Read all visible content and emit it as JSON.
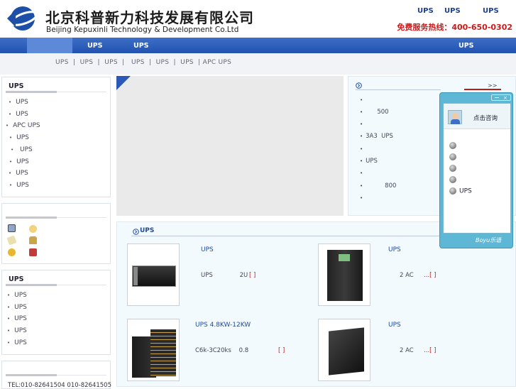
{
  "header": {
    "logo_cn": "北京科普新力科技发展有限公司",
    "logo_en": "Beijing Kepuxinli Technology & Development Co.Ltd",
    "top_links": [
      "UPS",
      "UPS",
      "UPS"
    ],
    "hotline": "免费服务热线：400-650-0302"
  },
  "nav": {
    "items": [
      "UPS",
      "UPS",
      "UPS"
    ]
  },
  "subnav": {
    "text": "UPS  |  UPS  |  UPS  |   UPS  |  UPS  |  UPS  | APC UPS"
  },
  "left_box1": {
    "title": "UPS",
    "items": [
      "UPS",
      "UPS",
      "APC UPS",
      "UPS",
      " UPS",
      "UPS",
      "UPS",
      "UPS"
    ]
  },
  "left_box3": {
    "title": "UPS",
    "items": [
      "UPS",
      "UPS",
      "UPS",
      "UPS",
      "UPS"
    ]
  },
  "contact": {
    "tel": "TEL:010-82641504 010-82641505"
  },
  "news": {
    "more": ">>",
    "items": [
      "",
      "      500",
      "",
      "3A3  UPS",
      "",
      "UPS",
      "",
      "          800",
      ""
    ]
  },
  "products": {
    "section_title": "UPS",
    "items": [
      {
        "title": "UPS",
        "desc": "UPS              2U",
        "more": "[ ]"
      },
      {
        "title": "UPS",
        "desc": "2 AC",
        "more": "...[ ]"
      },
      {
        "title": "UPS 4.8KW-12KW",
        "desc": "C6k-3C20ks    0.8",
        "more": "[ ]"
      },
      {
        "title": "UPS",
        "desc": "2 AC",
        "more": "...[ ]"
      }
    ]
  },
  "chat": {
    "header_label": "点击咨询",
    "rows": [
      "",
      "",
      "",
      "",
      "UPS"
    ],
    "brand": "Boyu乐语"
  },
  "colors": {
    "nav_blue": "#2152b0",
    "hotline_red": "#cc1a1a",
    "link_blue": "#1b3f8f"
  }
}
